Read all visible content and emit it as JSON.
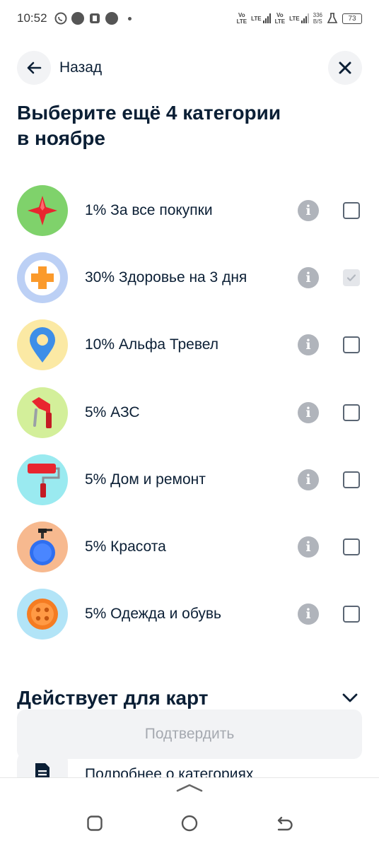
{
  "status": {
    "time": "10:52",
    "net1": [
      "Vo",
      "LTE"
    ],
    "net2": "LTE",
    "net3": [
      "Vo",
      "LTE"
    ],
    "net4": "LTE",
    "speed_value": "336",
    "speed_unit": "B/S",
    "battery": "73"
  },
  "header": {
    "back_label": "Назад"
  },
  "title": {
    "line1": "Выберите ещё 4 категории",
    "line2": "в ноябре"
  },
  "categories": [
    {
      "label": "1% За все покупки",
      "checked": false,
      "icon": "star-icon",
      "bg": "#7fd26b"
    },
    {
      "label": "30% Здоровье на 3 дня",
      "checked": true,
      "icon": "medical-cross-icon",
      "bg": "#bcd0f5"
    },
    {
      "label": "10% Альфа Тревел",
      "checked": false,
      "icon": "map-pin-icon",
      "bg": "#fbe9a4"
    },
    {
      "label": "5% АЗС",
      "checked": false,
      "icon": "fuel-nozzle-icon",
      "bg": "#d3ef9a"
    },
    {
      "label": "5% Дом и ремонт",
      "checked": false,
      "icon": "paint-roller-icon",
      "bg": "#9aeaf0"
    },
    {
      "label": "5% Красота",
      "checked": false,
      "icon": "perfume-bottle-icon",
      "bg": "#f7b98f"
    },
    {
      "label": "5% Одежда и обувь",
      "checked": false,
      "icon": "button-icon",
      "bg": "#b2e4f7"
    }
  ],
  "section": {
    "title": "Действует для карт"
  },
  "confirm_label": "Подтвердить",
  "more_label": "Подробнее о категориях",
  "colors": {
    "text": "#0b1f35",
    "info": "#b0b4bb",
    "button_bg": "#f2f3f5",
    "button_text": "#a5a9b0"
  }
}
